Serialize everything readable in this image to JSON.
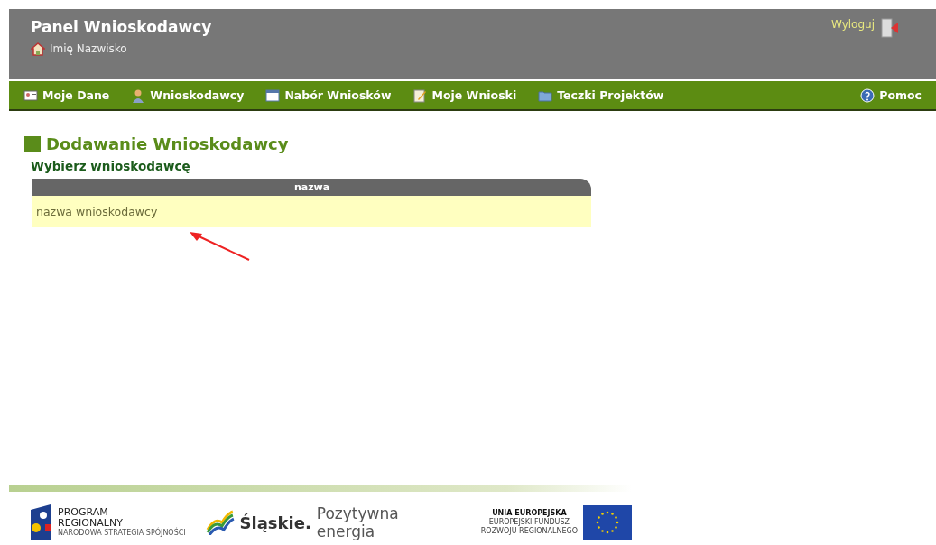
{
  "header": {
    "title": "Panel Wnioskodawcy",
    "user": "Imię Nazwisko",
    "logout": "Wyloguj"
  },
  "nav": [
    {
      "label": "Moje Dane",
      "kind": "card"
    },
    {
      "label": "Wnioskodawcy",
      "kind": "person"
    },
    {
      "label": "Nabór Wniosków",
      "kind": "window"
    },
    {
      "label": "Moje Wnioski",
      "kind": "pencil"
    },
    {
      "label": "Teczki Projektów",
      "kind": "folder"
    },
    {
      "label": "Pomoc",
      "kind": "help"
    }
  ],
  "page": {
    "title": "Dodawanie Wnioskodawcy",
    "subtitle": "Wybierz wnioskodawcę"
  },
  "table": {
    "columns": [
      "nazwa"
    ],
    "rows": [
      [
        "nazwa wnioskodawcy"
      ]
    ]
  },
  "footer": {
    "program": [
      "PROGRAM",
      "REGIONALNY",
      "NARODOWA STRATEGIA SPÓJNOŚCI"
    ],
    "slaskie": "Śląskie.",
    "slogan": "Pozytywna energia",
    "eu": [
      "UNIA EUROPEJSKA",
      "EUROPEJSKI FUNDUSZ",
      "ROZWOJU REGIONALNEGO"
    ]
  }
}
